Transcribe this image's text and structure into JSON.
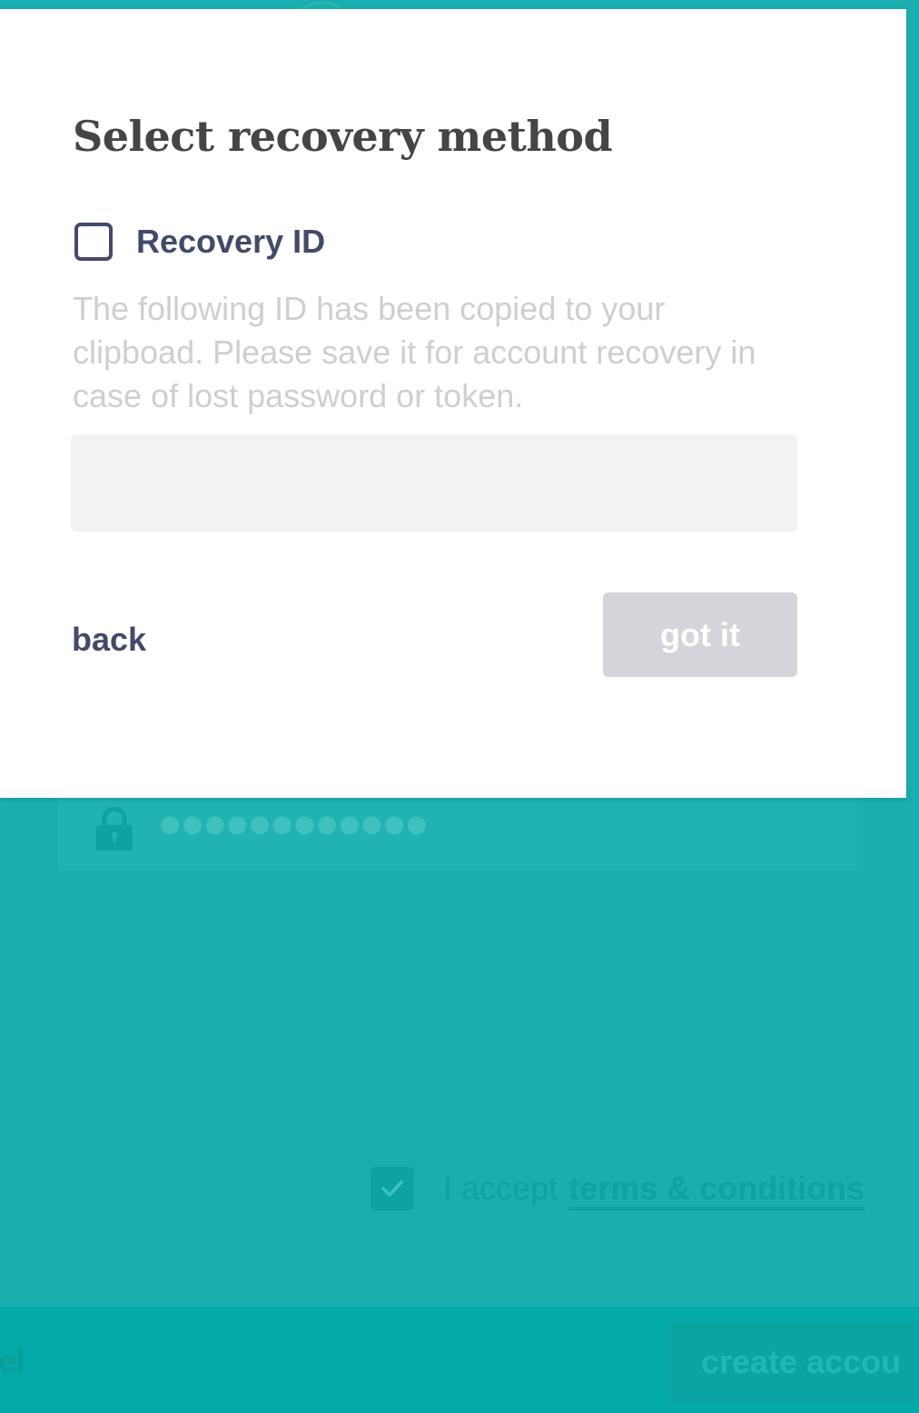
{
  "background_form": {
    "password_masked": "●●●●●●●●●●●●",
    "terms_prefix": "I accept",
    "terms_link": "terms & conditions",
    "terms_checked": true,
    "cancel_label": "ncel",
    "create_account_label": "create accou"
  },
  "modal": {
    "title": "Select recovery method",
    "option": {
      "label": "Recovery ID",
      "checked": false,
      "description": "The following ID has been copied to your clipboad.  Please save it for account recovery in case of lost password or token."
    },
    "recovery_id_value": "",
    "back_label": "back",
    "got_it_label": "got it"
  },
  "colors": {
    "background": "#1aafae",
    "text_primary": "#434a69",
    "title": "#454545",
    "muted_text": "#cfcfcf",
    "disabled_button": "#d4d5da",
    "field_background": "#f2f2f2"
  },
  "icons": {
    "lock": "lock-icon",
    "check": "check-icon"
  }
}
